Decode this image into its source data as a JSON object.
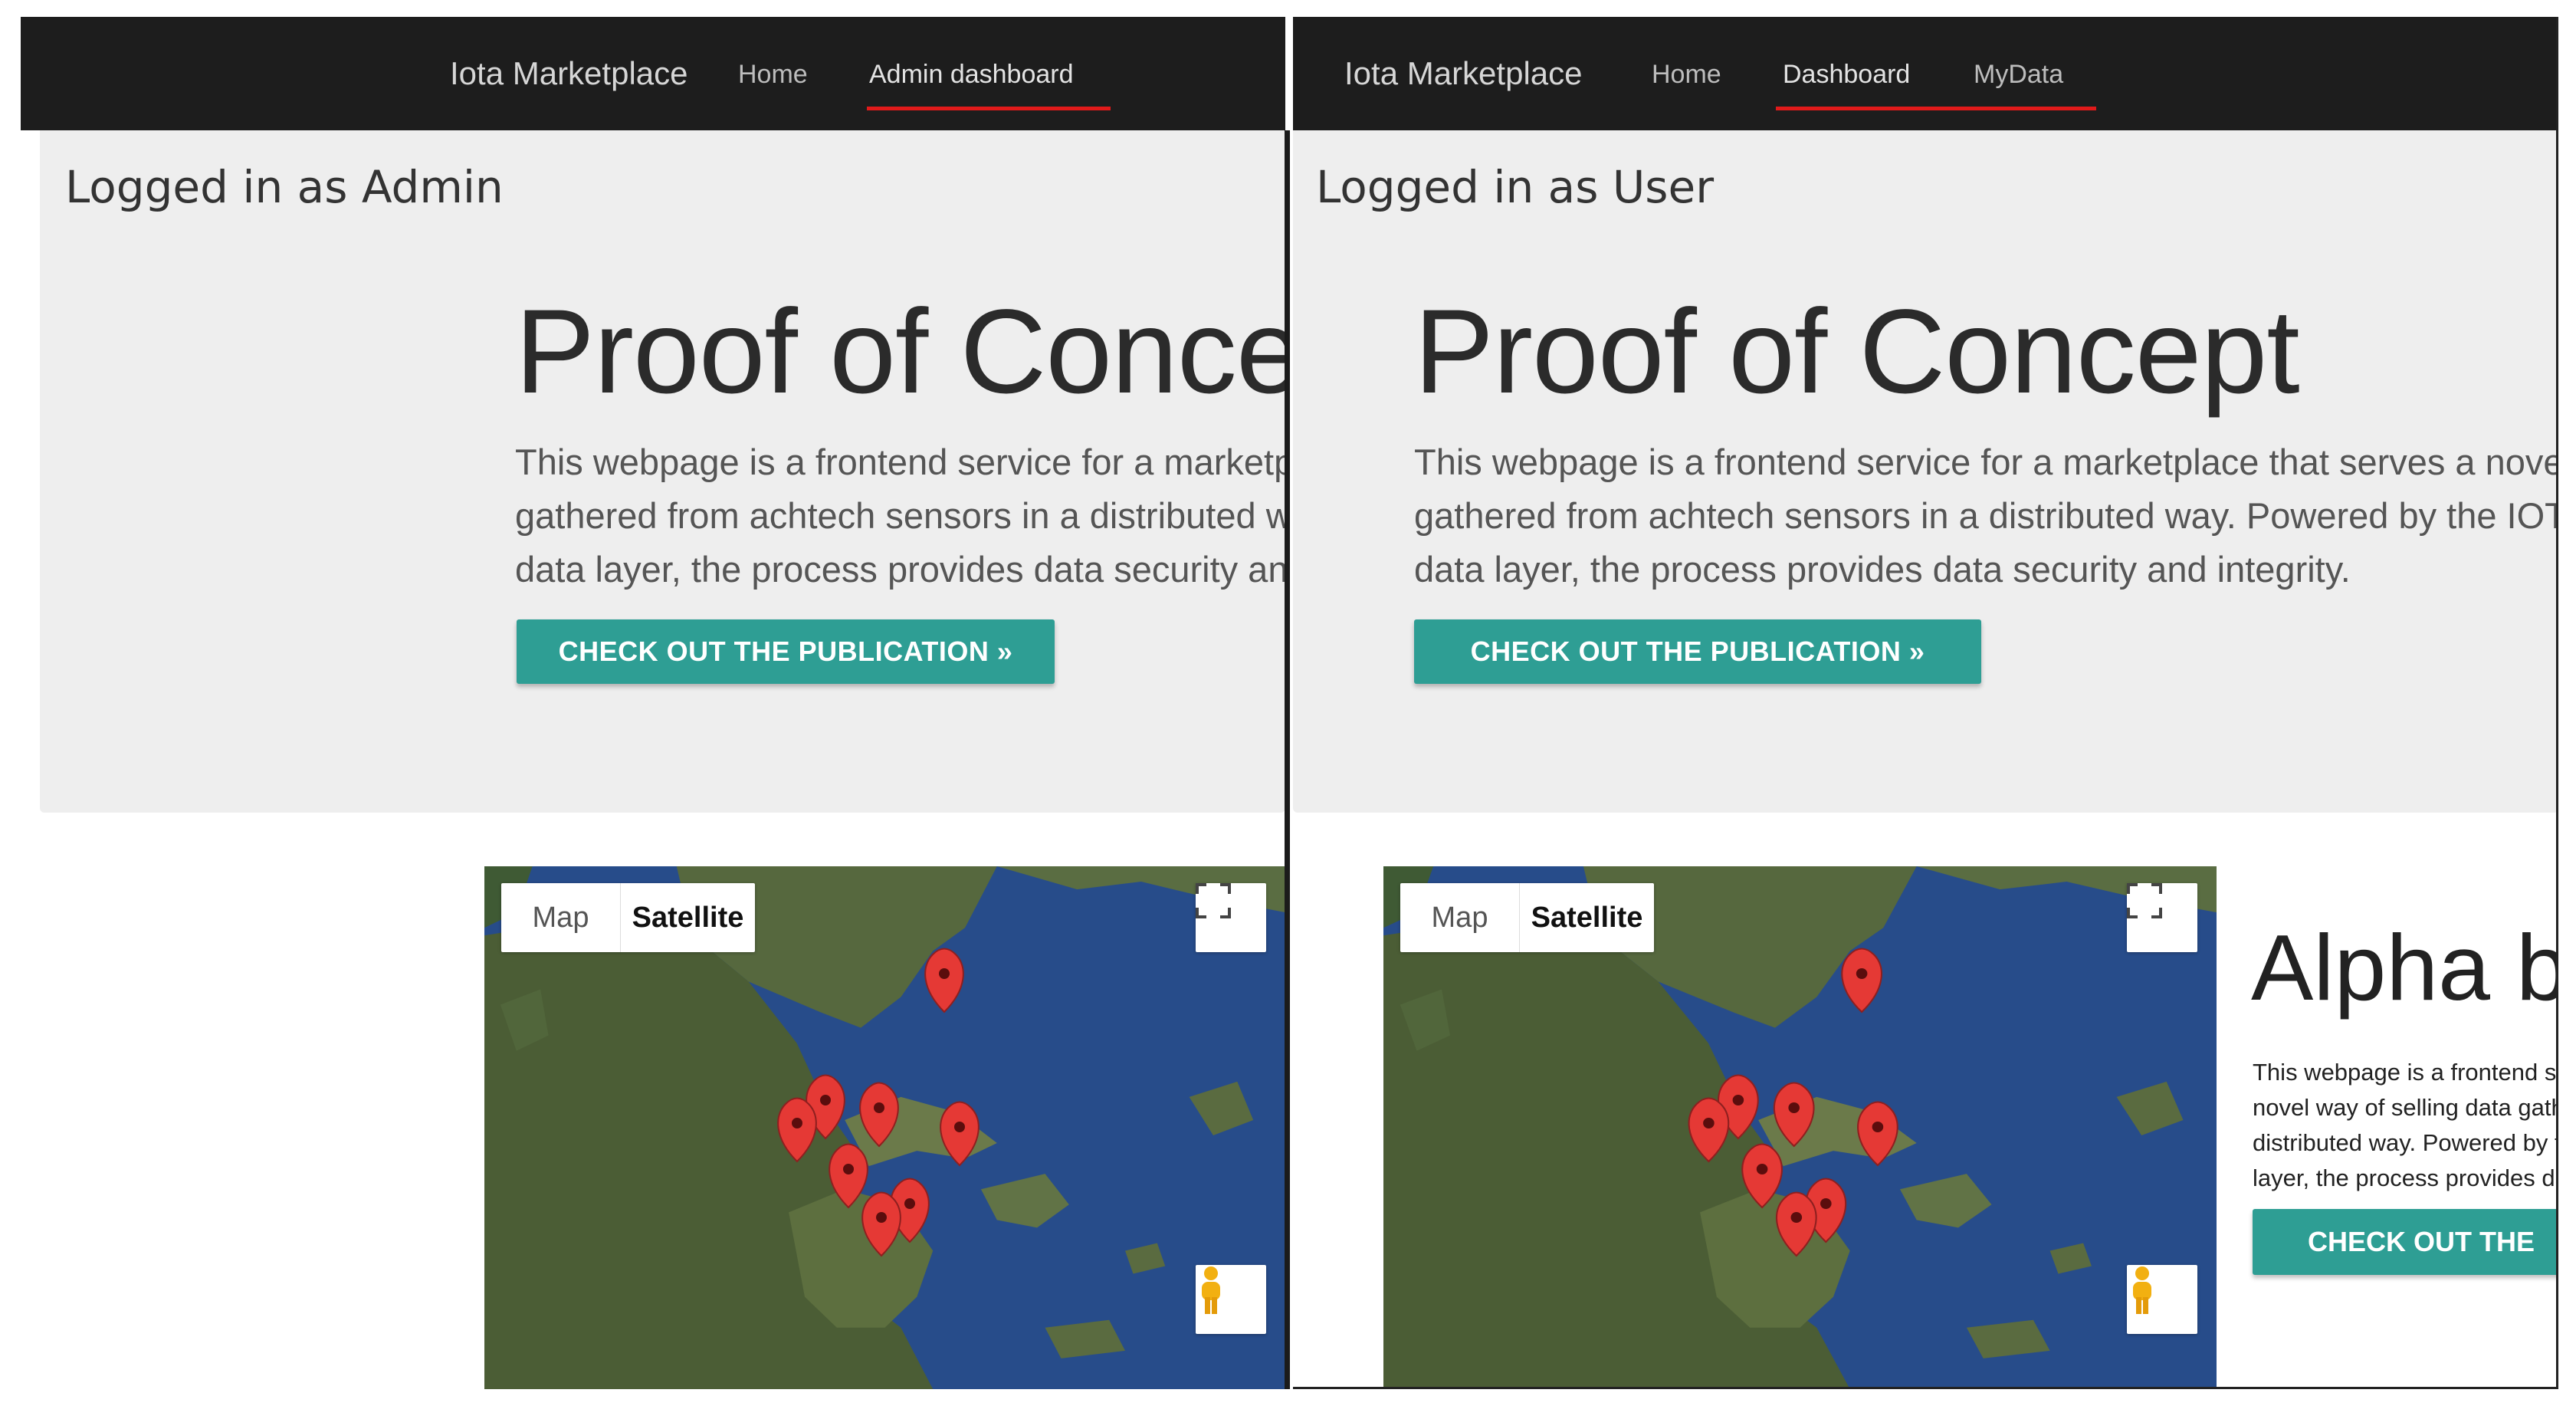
{
  "admin": {
    "navbar": {
      "brand": "Iota Marketplace",
      "links": [
        "Home",
        "Admin dashboard"
      ],
      "active": "Admin dashboard"
    },
    "logged_in": "Logged in as Admin",
    "hero": {
      "title": "Proof of Concept",
      "text_lines": [
        "This webpage is a frontend service for a marketplace that serves a novel way of selling data",
        "gathered from achtech sensors in a distributed way. Powered by the IOTA",
        "data layer, the process provides data security and integrity."
      ],
      "button": "CHECK OUT THE PUBLICATION »"
    },
    "map": {
      "map_label": "Map",
      "satellite_label": "Satellite",
      "selected": "Satellite",
      "icons": [
        "fullscreen-icon",
        "pegman-icon",
        "map-marker-icon"
      ]
    }
  },
  "user": {
    "navbar": {
      "brand": "Iota Marketplace",
      "links": [
        "Home",
        "Dashboard",
        "MyData"
      ],
      "active": "Dashboard"
    },
    "logged_in": "Logged in as User",
    "hero": {
      "title": "Proof of Concept",
      "text_lines": [
        "This webpage is a frontend service for a marketplace that serves a novel way of selling data",
        "gathered from achtech sensors in a distributed way. Powered by the IOTA",
        "data layer, the process provides data security and integrity."
      ],
      "button": "CHECK OUT THE PUBLICATION »"
    },
    "map": {
      "map_label": "Map",
      "satellite_label": "Satellite",
      "selected": "Satellite",
      "icons": [
        "fullscreen-icon",
        "pegman-icon",
        "map-marker-icon"
      ]
    },
    "alpha": {
      "title": "Alpha b",
      "text_lines": [
        "This webpage is a frontend service for a marketplace that serves a",
        "novel way of selling data gathered from achtech sensors in a",
        "distributed way. Powered by the IOTA data",
        "layer, the process provides data security"
      ],
      "button": "CHECK OUT THE"
    }
  },
  "colors": {
    "navbar": "#1d1d1d",
    "active_underline": "#e11a1a",
    "accent_button": "#2e9e94",
    "jumbotron": "#eeeeee",
    "marker": "#e53935"
  }
}
